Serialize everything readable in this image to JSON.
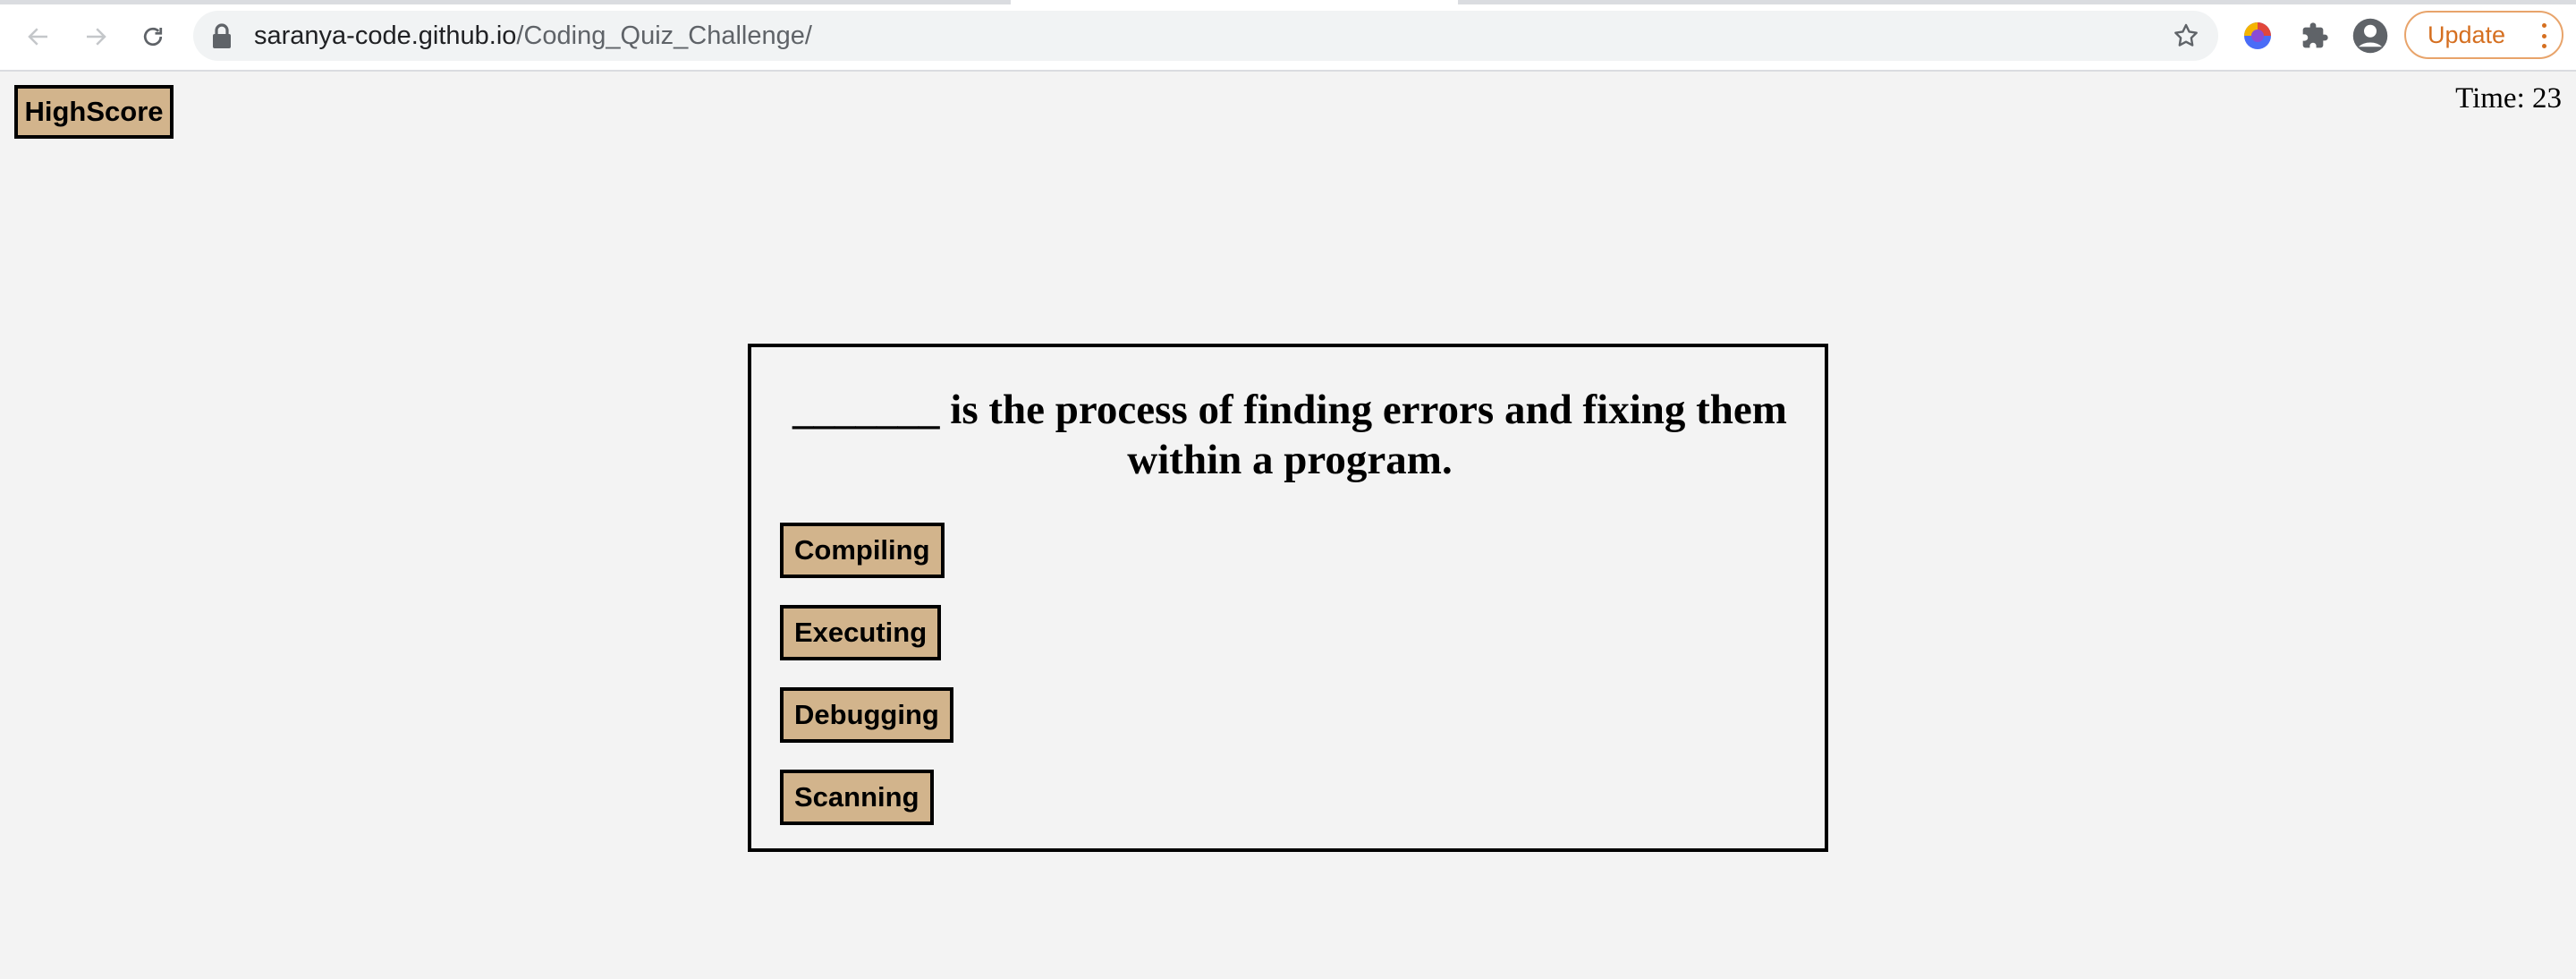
{
  "browser": {
    "url_host": "saranya-code.github.io",
    "url_path": "/Coding_Quiz_Challenge/",
    "update_label": "Update",
    "icons": {
      "back": "arrow-left-icon",
      "forward": "arrow-right-icon",
      "reload": "reload-icon",
      "lock": "lock-icon",
      "bookmark": "star-icon",
      "extension_colored": "color-extension-icon",
      "extensions": "puzzle-icon",
      "profile": "profile-icon",
      "menu": "kebab-menu-icon"
    },
    "colors": {
      "update_accent": "#d56f20"
    }
  },
  "page": {
    "highscore_label": "HighScore",
    "timer_text": "Time: 23",
    "quiz": {
      "question": "_______ is the process of finding errors and fixing them within a program.",
      "answers": [
        "Compiling",
        "Executing",
        "Debugging",
        "Scanning"
      ]
    },
    "colors": {
      "button_bg": "#d2b48c",
      "page_bg": "#f3f3f3",
      "border": "#000000"
    }
  }
}
